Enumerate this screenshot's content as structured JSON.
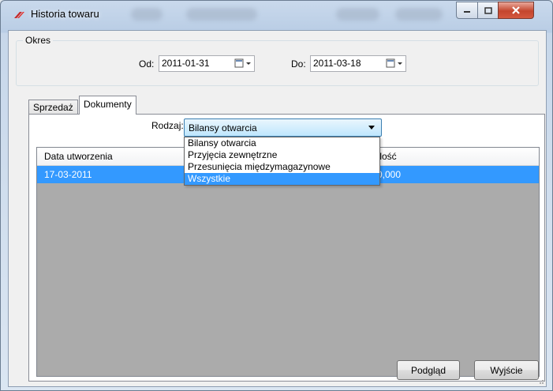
{
  "window": {
    "title": "Historia towaru"
  },
  "period": {
    "group_label": "Okres",
    "from_label": "Od:",
    "from_value": "2011-01-31",
    "to_label": "Do:",
    "to_value": "2011-03-18"
  },
  "tabs": [
    {
      "label": "Sprzedaż",
      "active": false
    },
    {
      "label": "Dokumenty",
      "active": true
    }
  ],
  "filter": {
    "label": "Rodzaj:",
    "selected": "Bilansy otwarcia",
    "options": [
      "Bilansy otwarcia",
      "Przyjęcia zewnętrzne",
      "Przesunięcia międzymagazynowe",
      "Wszystkie"
    ],
    "highlighted": "Wszystkie"
  },
  "grid": {
    "columns": [
      "Data utworzenia",
      "Ilość"
    ],
    "rows": [
      {
        "date": "17-03-2011",
        "qty": "0,000"
      }
    ]
  },
  "buttons": {
    "preview": "Podgląd",
    "exit": "Wyjście"
  },
  "colors": {
    "selection": "#3399ff",
    "grid_background": "#ababab",
    "close_button": "#c4452d"
  }
}
